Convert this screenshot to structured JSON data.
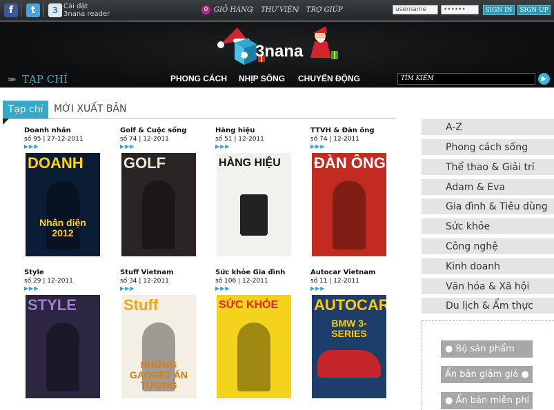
{
  "topbar": {
    "facebook_icon": "f",
    "twitter_icon": "t",
    "app_icon": "3",
    "install_line1": "Cài đặt",
    "install_line2": "3nana reader",
    "cart_count": "0",
    "cart_label": "GIỎ HÀNG",
    "library_label": "THƯ VIỆN",
    "help_label": "TRỢ GIÚP",
    "username_value": "username",
    "password_value": "••••••",
    "sign_in": "SIGN IN",
    "sign_up": "SIGN UP"
  },
  "header": {
    "logo_text": "3nana",
    "section_title": "TẠP CHÍ",
    "nav": [
      "PHONG CÁCH",
      "NHỊP SỐNG",
      "CHUYỂN ĐỘNG"
    ],
    "search_placeholder": "TÌM KIẾM"
  },
  "tabs": {
    "active": "Tạp chí",
    "new": "MỚI XUẤT BẢN"
  },
  "magazines": [
    {
      "title": "Doanh nhân",
      "issue": "số 95 | 27-12-2011",
      "cover_masthead": "DOANH",
      "cover_sub": "Nhân diện 2012",
      "bg": "#0b1d36",
      "accent": "#ffd400"
    },
    {
      "title": "Golf & Cuộc sống",
      "issue": "số 74 | 12-2011",
      "cover_masthead": "GOLF",
      "cover_sub": "",
      "bg": "#2a2424",
      "accent": "#e9e6dd"
    },
    {
      "title": "Hàng hiệu",
      "issue": "số 51 | 12-2011",
      "cover_masthead": "HÀNG HIỆU",
      "cover_sub": "",
      "bg": "#f2f1ee",
      "accent": "#111111"
    },
    {
      "title": "TTVH & Đàn ông",
      "issue": "số 74 | 12-2011",
      "cover_masthead": "ĐÀN ÔNG",
      "cover_sub": "",
      "bg": "#c42b20",
      "accent": "#ffffff"
    },
    {
      "title": "Style",
      "issue": "số 29 | 12-2011",
      "cover_masthead": "STYLE",
      "cover_sub": "",
      "bg": "#2c2640",
      "accent": "#9d7fd2"
    },
    {
      "title": "Stuff Vietnam",
      "issue": "số 34 | 12-2011",
      "cover_masthead": "Stuff",
      "cover_sub": "NHỮNG GADGET ẤN TƯỢNG",
      "bg": "#f3efe4",
      "accent": "#f2a51c"
    },
    {
      "title": "Sức khỏe Gia đình",
      "issue": "số 106 | 12-2011",
      "cover_masthead": "SỨC KHỎE",
      "cover_sub": "",
      "bg": "#f4d31c",
      "accent": "#e02a20"
    },
    {
      "title": "Autocar Vietnam",
      "issue": "số 11 | 12-2011",
      "cover_masthead": "AUTOCAR",
      "cover_sub": "BMW 3-SERIES",
      "bg": "#1d3d6a",
      "accent": "#ffcc00"
    }
  ],
  "sidebar": {
    "categories": [
      "A-Z",
      "Phong cách sống",
      "Thể thao & Giải trí",
      "Adam & Eva",
      "Gia đình & Tiêu dùng",
      "Sức khỏe",
      "Công nghệ",
      "Kinh doanh",
      "Văn hóa & Xã hội",
      "Du lịch & Ẩm thực"
    ],
    "pills": [
      "Bộ sản phẩm",
      "Ấn bản giảm giá",
      "Ấn bản miễn phí"
    ]
  }
}
